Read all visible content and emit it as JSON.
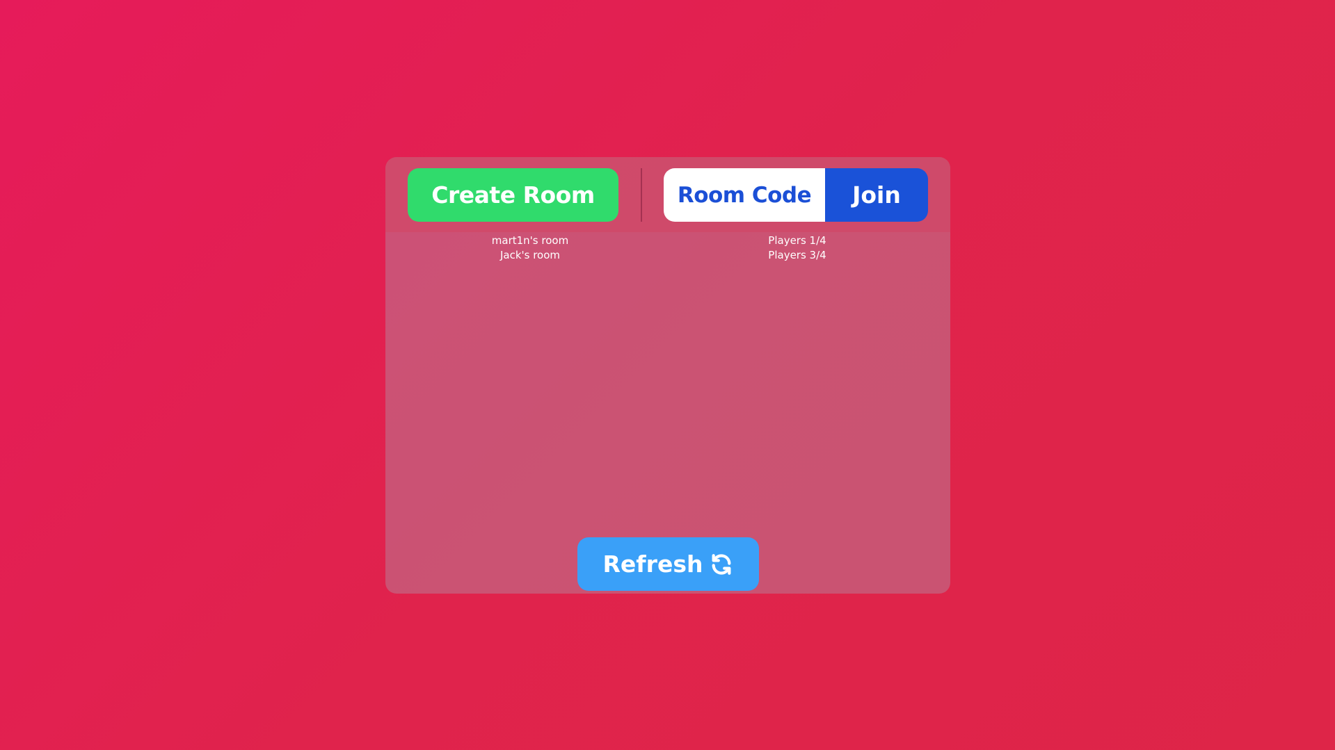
{
  "lobby": {
    "create_label": "Create Room",
    "code_placeholder": "Room Code",
    "code_value": "",
    "join_label": "Join",
    "refresh_label": "Refresh",
    "refresh_icon": "refresh-icon"
  },
  "rooms": [
    {
      "name": "mart1n's room",
      "players": "Players 1/4"
    },
    {
      "name": "Jack's room",
      "players": "Players 3/4"
    }
  ],
  "colors": {
    "background": "#e0234c",
    "create": "#30db6c",
    "join": "#1a52d8",
    "code_text": "#1b4fd6",
    "refresh": "#3aa0f8"
  }
}
